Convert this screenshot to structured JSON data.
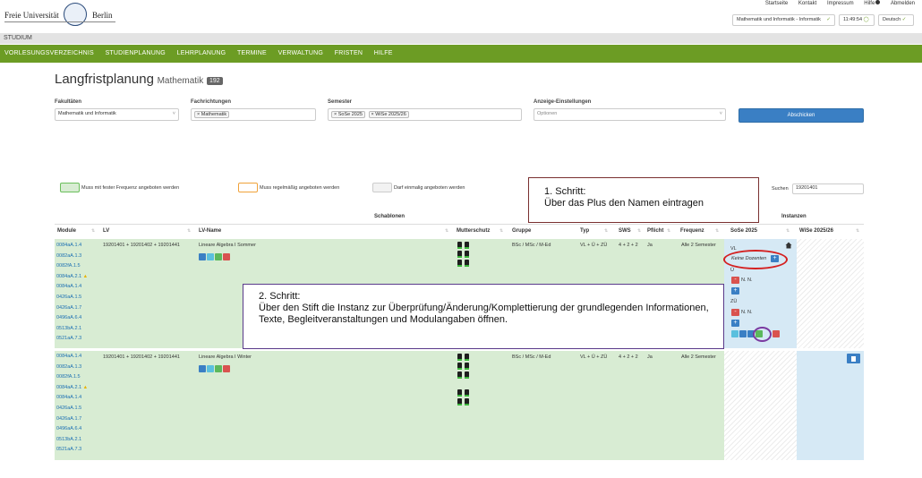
{
  "header": {
    "logo_left": "Freie Universität",
    "logo_right": "Berlin",
    "top_links": [
      "Startseite",
      "Kontakt",
      "Impressum",
      "Hilfe",
      "Abmelden"
    ],
    "faculty_select": "Mathematik und Informatik - Informatik",
    "clock": "11:49:54",
    "language": "Deutsch"
  },
  "section_bar": "STUDIUM",
  "main_nav": [
    "VORLESUNGSVERZEICHNIS",
    "STUDIENPLANUNG",
    "LEHRPLANUNG",
    "TERMINE",
    "VERWALTUNG",
    "FRISTEN",
    "HILFE"
  ],
  "page": {
    "title": "Langfristplanung",
    "subtitle": "Mathematik",
    "count": "192"
  },
  "filters": {
    "fakultaeten_label": "Fakultäten",
    "fakultaeten_value": "Mathematik und Informatik",
    "fachrichtungen_label": "Fachrichtungen",
    "fachrichtungen_tags": [
      "× Mathematik"
    ],
    "semester_label": "Semester",
    "semester_tags": [
      "× SoSe 2025",
      "× WiSe 2025/26"
    ],
    "anzeige_label": "Anzeige-Einstellungen",
    "anzeige_placeholder": "Optionen",
    "submit_label": "Abschicken"
  },
  "legend": {
    "fixed": "Muss mit fester Frequenz angeboten werden",
    "regular": "Muss regelmäßig angeboten werden",
    "once": "Darf einmalig angeboten werden",
    "colors": {
      "fixed": "#d8ecd3",
      "regular": "#fbe3b8",
      "once": "#f2f2f2"
    }
  },
  "search": {
    "label": "Suchen",
    "value": "19201401"
  },
  "table": {
    "group_schablonen": "Schablonen",
    "group_instanzen": "Instanzen",
    "columns": [
      "Module",
      "LV",
      "LV-Name",
      "Mutterschutz",
      "Gruppe",
      "Typ",
      "SWS",
      "Pflicht",
      "Frequenz",
      "SoSe 2025",
      "WiSe 2025/26"
    ],
    "rows": [
      {
        "modules": [
          "0084aA.1.4",
          "0082aA.1.3",
          "0082fA.1.5",
          "0084aA.2.1",
          "0084aA.1.4",
          "0426aA.1.5",
          "0426aA.1.7",
          "0496aA.6.4",
          "0513bA.2.1",
          "0521aA.7.3"
        ],
        "lv": "19201401 + 19201402 + 19201441",
        "lv_name": "Lineare Algebra I Sommer",
        "gruppe": "BSc / MSc / M-Ed",
        "typ": "VL + Ü + ZÜ",
        "sws": "4 + 2 + 2",
        "pflicht": "Ja",
        "frequenz": "Alle 2 Semester",
        "instance": {
          "vl_label": "VL",
          "keine_dozenten": "Keine Dozenten",
          "u_label": "Ü",
          "zu_label": "ZÜ",
          "nn": "N. N."
        }
      },
      {
        "modules": [
          "0084aA.1.4",
          "0082aA.1.3",
          "0082fA.1.5",
          "0084aA.2.1",
          "0084aA.1.4",
          "0426aA.1.5",
          "0426aA.1.7",
          "0496aA.6.4",
          "0513bA.2.1",
          "0521aA.7.3"
        ],
        "lv": "19201401 + 19201402 + 19201441",
        "lv_name": "Lineare Algebra I Winter",
        "gruppe": "BSc / MSc / M-Ed",
        "typ": "VL + Ü + ZÜ",
        "sws": "4 + 2 + 2",
        "pflicht": "Ja",
        "frequenz": "Alle 2 Semester"
      }
    ]
  },
  "callouts": {
    "step1_title": "1.  Schritt:",
    "step1_text": "Über das Plus den Namen eintragen",
    "step2_title": "2. Schritt:",
    "step2_text": "Über den Stift die Instanz zur Überprüfung/Änderung/Komplettierung der grundlegenden Informationen, Texte, Begleitveranstaltungen und Modulangaben öffnen."
  }
}
